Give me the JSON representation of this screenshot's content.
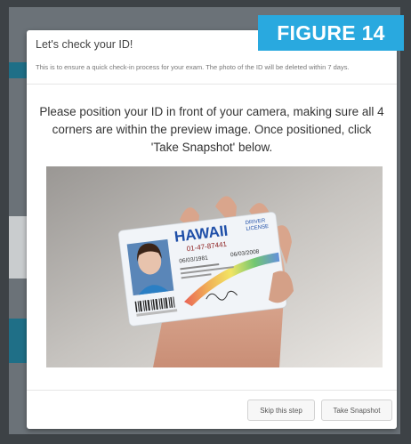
{
  "figure_label": "FIGURE 14",
  "modal": {
    "title": "Let's check your ID!",
    "subtitle": "This is to ensure a quick check-in process for your exam. The photo of the ID will be deleted within 7 days.",
    "instructions": "Please position your ID in front of your camera, making sure all 4 corners are within the preview image. Once positioned, click 'Take Snapshot' below."
  },
  "id_card": {
    "state": "HAWAII",
    "type_line1": "DRIVER",
    "type_line2": "LICENSE",
    "number": "01-47-87441",
    "date1": "06/03/1981",
    "date2": "06/03/2008"
  },
  "buttons": {
    "skip": "Skip this step",
    "snapshot": "Take Snapshot"
  },
  "colors": {
    "badge": "#29a9df",
    "id_blue": "#1f4fa8"
  }
}
